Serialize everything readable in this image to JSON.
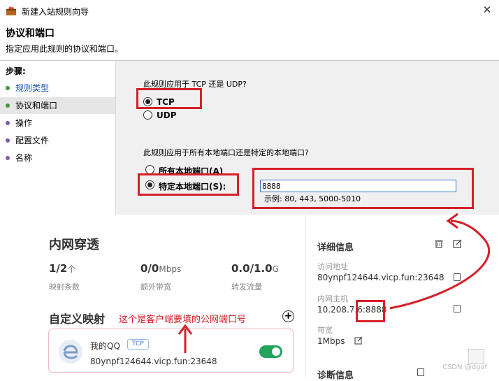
{
  "window": {
    "title": "新建入站规则向导",
    "close_glyph": "✕"
  },
  "header": {
    "title": "协议和端口",
    "description": "指定应用此规则的协议和端口。"
  },
  "steps": {
    "label": "步骤:",
    "items": [
      {
        "label": "规则类型",
        "state": "done"
      },
      {
        "label": "协议和端口",
        "state": "current"
      },
      {
        "label": "操作",
        "state": "pending"
      },
      {
        "label": "配置文件",
        "state": "pending"
      },
      {
        "label": "名称",
        "state": "pending"
      }
    ]
  },
  "protocol": {
    "question": "此规则应用于 TCP 还是 UDP?",
    "options": [
      "TCP",
      "UDP"
    ],
    "selected": "TCP"
  },
  "ports": {
    "question": "此规则应用于所有本地端口还是特定的本地端口?",
    "options": [
      "所有本地端口(A)",
      "特定本地端口(S):"
    ],
    "selected": "特定本地端口(S):",
    "value": "8888",
    "example": "示例: 80, 443, 5000-5010"
  },
  "np": {
    "title": "内网穿透",
    "stats": [
      {
        "value": "1/2",
        "unit": "个",
        "label": "映射条数"
      },
      {
        "value": "0/0",
        "unit": "Mbps",
        "label": "额外带宽"
      },
      {
        "value": "0.0/1.0",
        "unit": "G",
        "label": "转发流量"
      }
    ],
    "mapping_title": "自定义映射",
    "annotation": "这个是客户端要填的公网端口号",
    "add_glyph": "+",
    "mapping": {
      "name": "我的QQ",
      "protocol": "TCP",
      "address": "80ynpf124644.vicp.fun:23648",
      "enabled": true
    }
  },
  "details": {
    "title": "详细信息",
    "access_label": "访问地址",
    "access_value": "80ynpf124644.vicp.fun:23648",
    "host_label": "内网主机",
    "host_value": "10.208.7.6:8888",
    "bandwidth_label": "带宽",
    "bandwidth_value": "1Mbps",
    "diag_title": "诊断信息"
  },
  "watermark": "CSDN @dgaf",
  "colors": {
    "accent_red": "#d6202a",
    "done_dot": "#3c9a3c",
    "pending_dot": "#7a5fa0",
    "toggle_on": "#23a35b"
  }
}
